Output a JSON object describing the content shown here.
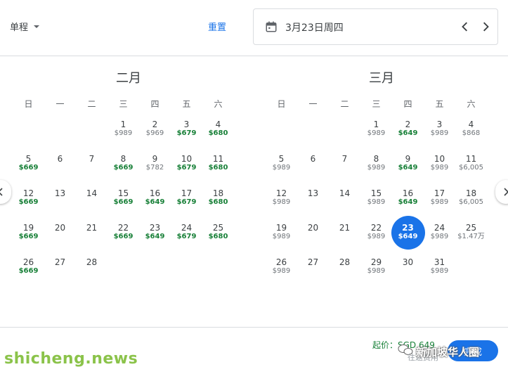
{
  "header": {
    "trip_type": "单程",
    "reset_label": "重置",
    "selected_date": "3月23日周四",
    "calendar_icon": "calendar-icon",
    "prev_icon": "chevron-left-icon",
    "next_icon": "chevron-right-icon"
  },
  "weekdays": [
    "日",
    "一",
    "二",
    "三",
    "四",
    "五",
    "六"
  ],
  "months": [
    {
      "title": "二月",
      "offset": 3,
      "days": [
        {
          "d": "1",
          "p": "$989",
          "low": false
        },
        {
          "d": "2",
          "p": "$969",
          "low": false
        },
        {
          "d": "3",
          "p": "$679",
          "low": true
        },
        {
          "d": "4",
          "p": "$680",
          "low": true
        },
        {
          "d": "5",
          "p": "$669",
          "low": true
        },
        {
          "d": "6",
          "p": "",
          "low": false
        },
        {
          "d": "7",
          "p": "",
          "low": false
        },
        {
          "d": "8",
          "p": "$669",
          "low": true
        },
        {
          "d": "9",
          "p": "$782",
          "low": false
        },
        {
          "d": "10",
          "p": "$679",
          "low": true
        },
        {
          "d": "11",
          "p": "$680",
          "low": true
        },
        {
          "d": "12",
          "p": "$669",
          "low": true
        },
        {
          "d": "13",
          "p": "",
          "low": false
        },
        {
          "d": "14",
          "p": "",
          "low": false
        },
        {
          "d": "15",
          "p": "$669",
          "low": true
        },
        {
          "d": "16",
          "p": "$649",
          "low": true
        },
        {
          "d": "17",
          "p": "$679",
          "low": true
        },
        {
          "d": "18",
          "p": "$680",
          "low": true
        },
        {
          "d": "19",
          "p": "$669",
          "low": true
        },
        {
          "d": "20",
          "p": "",
          "low": false
        },
        {
          "d": "21",
          "p": "",
          "low": false
        },
        {
          "d": "22",
          "p": "$669",
          "low": true
        },
        {
          "d": "23",
          "p": "$649",
          "low": true
        },
        {
          "d": "24",
          "p": "$679",
          "low": true
        },
        {
          "d": "25",
          "p": "$680",
          "low": true
        },
        {
          "d": "26",
          "p": "$669",
          "low": true
        },
        {
          "d": "27",
          "p": "",
          "low": false
        },
        {
          "d": "28",
          "p": "",
          "low": false
        }
      ]
    },
    {
      "title": "三月",
      "offset": 3,
      "days": [
        {
          "d": "1",
          "p": "$989",
          "low": false
        },
        {
          "d": "2",
          "p": "$649",
          "low": true
        },
        {
          "d": "3",
          "p": "$989",
          "low": false
        },
        {
          "d": "4",
          "p": "$868",
          "low": false
        },
        {
          "d": "5",
          "p": "$989",
          "low": false
        },
        {
          "d": "6",
          "p": "",
          "low": false
        },
        {
          "d": "7",
          "p": "",
          "low": false
        },
        {
          "d": "8",
          "p": "$989",
          "low": false
        },
        {
          "d": "9",
          "p": "$649",
          "low": true
        },
        {
          "d": "10",
          "p": "$989",
          "low": false
        },
        {
          "d": "11",
          "p": "$6,005",
          "low": false
        },
        {
          "d": "12",
          "p": "$989",
          "low": false
        },
        {
          "d": "13",
          "p": "",
          "low": false
        },
        {
          "d": "14",
          "p": "",
          "low": false
        },
        {
          "d": "15",
          "p": "$989",
          "low": false
        },
        {
          "d": "16",
          "p": "$649",
          "low": true
        },
        {
          "d": "17",
          "p": "$989",
          "low": false
        },
        {
          "d": "18",
          "p": "$6,005",
          "low": false
        },
        {
          "d": "19",
          "p": "$989",
          "low": false
        },
        {
          "d": "20",
          "p": "",
          "low": false
        },
        {
          "d": "21",
          "p": "",
          "low": false
        },
        {
          "d": "22",
          "p": "$989",
          "low": false
        },
        {
          "d": "23",
          "p": "$649",
          "low": true,
          "selected": true
        },
        {
          "d": "24",
          "p": "$989",
          "low": false
        },
        {
          "d": "25",
          "p": "$1.47万",
          "low": false
        },
        {
          "d": "26",
          "p": "$989",
          "low": false
        },
        {
          "d": "27",
          "p": "",
          "low": false
        },
        {
          "d": "28",
          "p": "",
          "low": false
        },
        {
          "d": "29",
          "p": "$989",
          "low": false
        },
        {
          "d": "30",
          "p": "",
          "low": false
        },
        {
          "d": "31",
          "p": "$989",
          "low": false
        }
      ]
    }
  ],
  "footer": {
    "from_price": "起价：SGD 649",
    "done_label": "完成",
    "watermark": "新加坡华人圈",
    "overlay": "往返费用"
  },
  "site_mark": "shicheng.news",
  "colors": {
    "accent": "#1a73e8",
    "low_price": "#188038",
    "regular_price": "#70757a"
  }
}
